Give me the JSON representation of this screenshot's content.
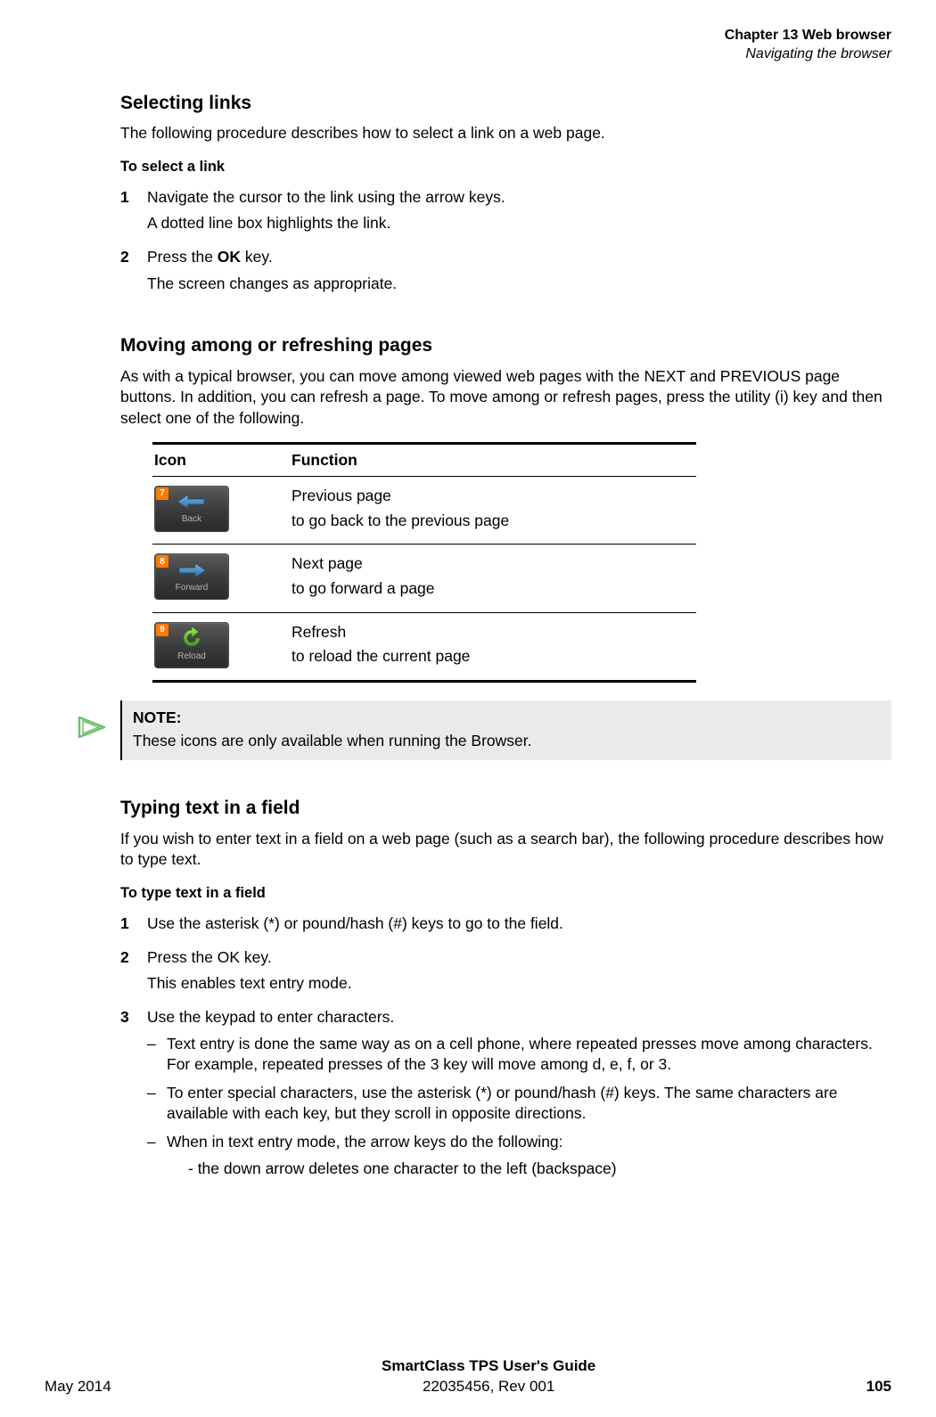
{
  "header": {
    "chapter": "Chapter 13  Web browser",
    "section": "Navigating the browser"
  },
  "s1": {
    "title": "Selecting links",
    "intro": "The following procedure describes how to select a link on a web page.",
    "sub": "To select a link",
    "step1a": "Navigate the cursor to the link using the arrow keys.",
    "step1b": "A dotted line box highlights the link.",
    "step2a_pre": "Press the ",
    "step2a_bold": "OK",
    "step2a_post": " key.",
    "step2b": "The screen changes as appropriate."
  },
  "s2": {
    "title": "Moving among or refreshing pages",
    "intro": "As with a typical browser, you can move among viewed web pages with the NEXT and PREVIOUS page buttons. In addition, you can refresh a page. To move among or refresh pages, press the utility (i) key and then select one of the following.",
    "th_icon": "Icon",
    "th_func": "Function",
    "rows": [
      {
        "badge": "7",
        "label": "Back",
        "name": "Previous page",
        "desc": "to go back to the previous page",
        "icon": "back"
      },
      {
        "badge": "8",
        "label": "Forward",
        "name": "Next page",
        "desc": "to go forward a page",
        "icon": "forward"
      },
      {
        "badge": "9",
        "label": "Reload",
        "name": "Refresh",
        "desc": "to reload the current page",
        "icon": "reload"
      }
    ],
    "note_title": "NOTE:",
    "note_body": "These icons are only available when running the Browser."
  },
  "s3": {
    "title": "Typing text in a field",
    "intro": "If you wish to enter text in a field on a web page (such as a search bar), the following procedure describes how to type text.",
    "sub": "To type text in a field",
    "step1": "Use the asterisk (*) or pound/hash (#) keys to go to the field.",
    "step2a": "Press the OK key.",
    "step2b": "This enables text entry mode.",
    "step3": "Use the keypad to enter characters.",
    "d1": "Text entry is done the same way as on a cell phone, where repeated presses move among characters. For example, repeated presses of the 3 key will move among d, e, f, or 3.",
    "d2": "To enter special characters, use the asterisk (*) or pound/hash (#) keys. The same characters are available with each key, but they scroll in opposite directions.",
    "d3": "When in text entry mode, the arrow keys do the following:",
    "d3a": "-  the down arrow deletes one character to the left (backspace)"
  },
  "footer": {
    "left": "May 2014",
    "center1": "SmartClass TPS User's Guide",
    "center2": "22035456, Rev 001",
    "right": "105"
  }
}
